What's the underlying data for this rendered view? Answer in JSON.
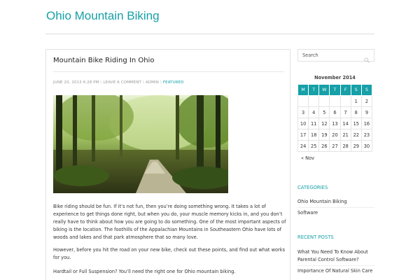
{
  "site": {
    "title": "Ohio Mountain Biking"
  },
  "post": {
    "title": "Mountain Bike Riding In Ohio",
    "meta": {
      "date": "JUNE 20, 2013 6:28 PM",
      "comments": "LEAVE A COMMENT",
      "author": "ADMIN",
      "category": "FEATURED"
    },
    "paragraphs": [
      "Bike riding should be fun. If it’s not fun, then you’re doing something wrong. It takes a lot of experience to get things done right, but when you do, your muscle memory kicks in, and you don’t really have to think about how you are going to do something. One of the most important aspects of biking is the location. The foothills of the Appalachian Mountains in Southeastern Ohio have lots of woods and lakes and that park atmosphere that so many love.",
      "However, before you hit the road on your new bike, check out these points, and find out what works for you.",
      "Hardtail or Full Suspension? You’ll need the right one for Ohio mountain biking."
    ]
  },
  "sidebar": {
    "search": {
      "placeholder": "Search",
      "icon": "search-icon"
    },
    "calendar": {
      "caption": "November 2014",
      "days": [
        "M",
        "T",
        "W",
        "T",
        "F",
        "S",
        "S"
      ],
      "weeks": [
        [
          "",
          "",
          "",
          "",
          "",
          "1",
          "2"
        ],
        [
          "3",
          "4",
          "5",
          "6",
          "7",
          "8",
          "9"
        ],
        [
          "10",
          "11",
          "12",
          "13",
          "14",
          "15",
          "16"
        ],
        [
          "17",
          "18",
          "19",
          "20",
          "21",
          "22",
          "23"
        ],
        [
          "24",
          "25",
          "26",
          "27",
          "28",
          "29",
          "30"
        ]
      ],
      "prev": "« Nov"
    },
    "categories": {
      "title": "CATEGORIES",
      "items": [
        "Ohio Mountain Biking",
        "Software"
      ]
    },
    "recent_posts": {
      "title": "RECENT POSTS",
      "items": [
        "What You Need To Know About Parental Control Software?",
        "Importance Of Natural Skin Care"
      ]
    }
  },
  "colors": {
    "accent": "#16a0a7",
    "text": "#333333",
    "muted": "#999999",
    "border": "#e2e2e2"
  }
}
